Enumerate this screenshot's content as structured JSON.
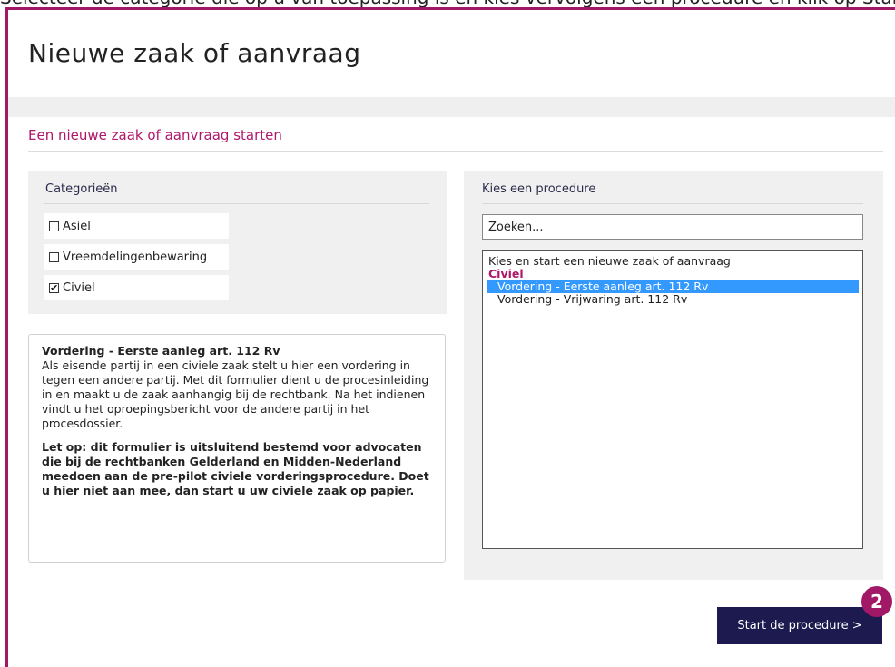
{
  "caption": "Selecteer de categorie die op u van toepassing is en kies vervolgens een procedure en klik op Start de procedure",
  "page_title": "Nieuwe zaak of aanvraag",
  "section_heading": "Een nieuwe zaak of aanvraag starten",
  "categories": {
    "title": "Categorieën",
    "items": [
      {
        "label": "Asiel",
        "checked": false,
        "mark": ""
      },
      {
        "label": "Vreemdelingenbewaring",
        "checked": false,
        "mark": ""
      },
      {
        "label": "Civiel",
        "checked": true,
        "mark": "✔"
      }
    ]
  },
  "procedure": {
    "title": "Kies een procedure",
    "search_placeholder": "Zoeken...",
    "list": {
      "intro": "Kies en start een nieuwe zaak of aanvraag",
      "group": "Civiel",
      "options": [
        {
          "label": "Vordering - Eerste aanleg art. 112 Rv",
          "selected": true
        },
        {
          "label": "Vordering - Vrijwaring art. 112 Rv",
          "selected": false
        }
      ]
    }
  },
  "description": {
    "title": "Vordering - Eerste aanleg art. 112 Rv",
    "body": "Als eisende partij in een civiele zaak stelt u hier een vordering in tegen een andere partij. Met dit formulier dient u de procesinleiding in en maakt u de zaak aanhangig bij de rechtbank. Na het indienen vindt u het oproepingsbericht voor de andere partij in het procesdossier.",
    "warning": "Let op: dit formulier is uitsluitend bestemd voor advocaten die bij de rechtbanken Gelderland en Midden-Nederland meedoen aan de pre-pilot civiele vorderingsprocedure. Doet u hier niet aan mee, dan start u uw civiele zaak op papier."
  },
  "start_button": "Start de procedure >",
  "step_badge": "2",
  "colors": {
    "accent": "#a01866",
    "button_bg": "#1d1a4f",
    "selection": "#3399ff"
  }
}
